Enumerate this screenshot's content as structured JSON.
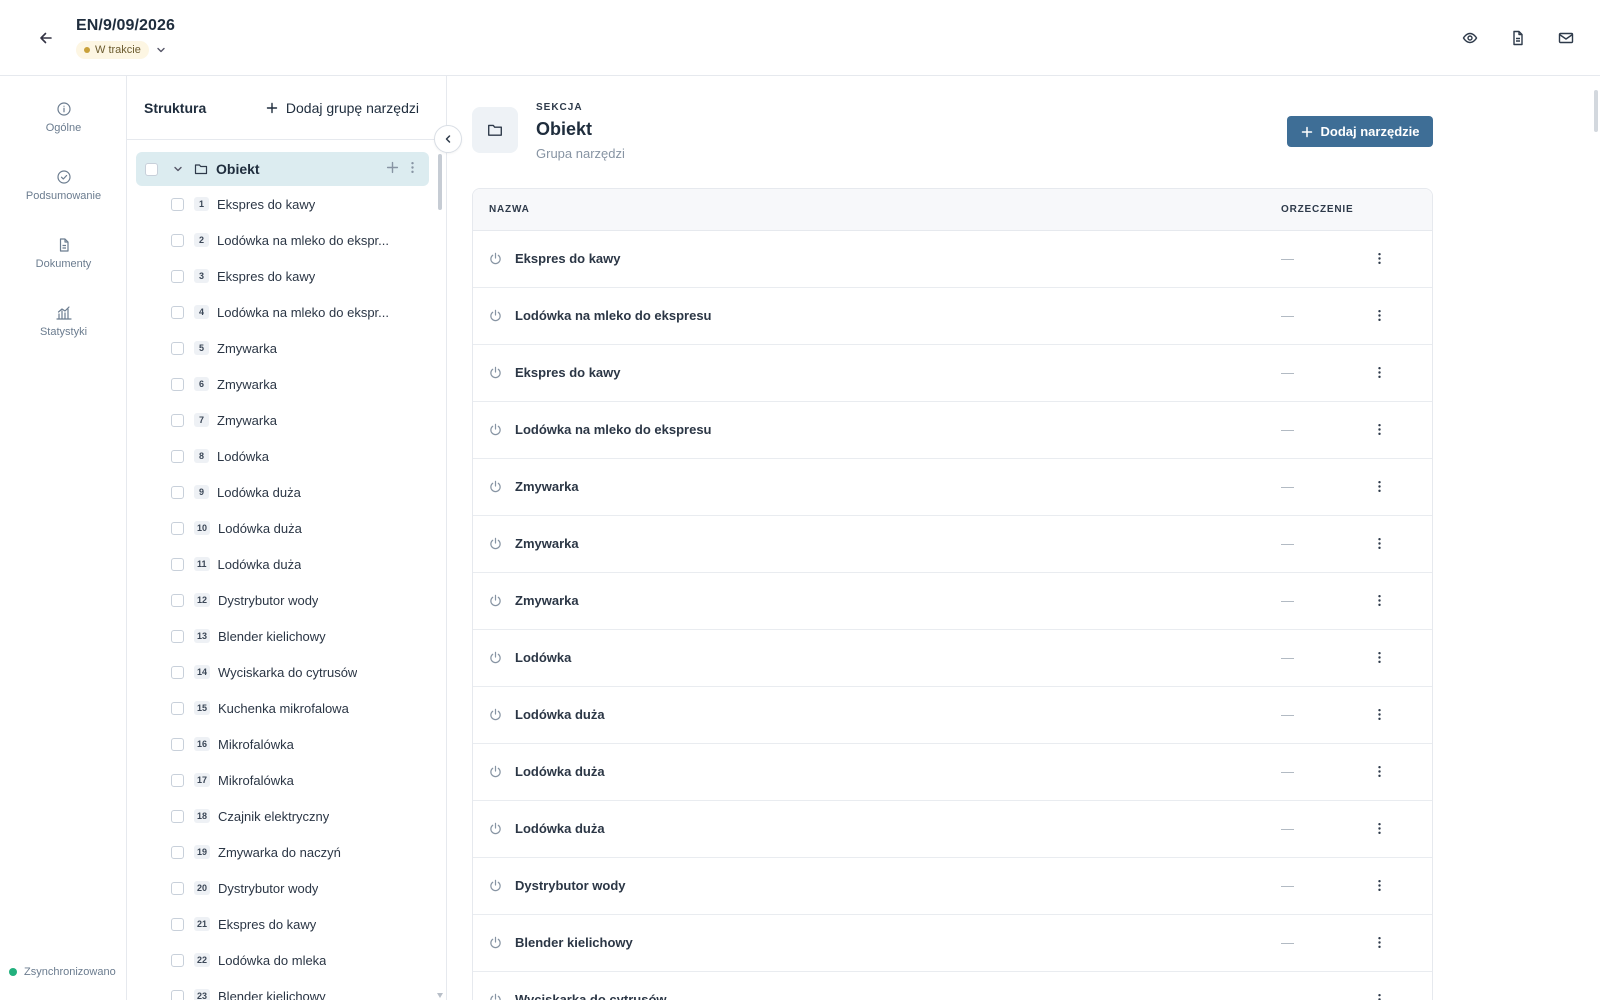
{
  "header": {
    "title": "EN/9/09/2026",
    "status": "W trakcie",
    "status_color": "#c9a13a",
    "actions": [
      "eye-icon",
      "document-icon",
      "mail-icon"
    ]
  },
  "nav": {
    "items": [
      {
        "label": "Ogólne",
        "icon": "info-icon"
      },
      {
        "label": "Podsumowanie",
        "icon": "check-circle-icon"
      },
      {
        "label": "Dokumenty",
        "icon": "document-icon"
      },
      {
        "label": "Statystyki",
        "icon": "chart-icon"
      }
    ],
    "sync_label": "Zsynchronizowano",
    "sync_color": "#22b07d"
  },
  "tree": {
    "title": "Struktura",
    "add_group_label": "Dodaj grupę narzędzi",
    "root_label": "Obiekt",
    "items": [
      {
        "num": "1",
        "label": "Ekspres do kawy"
      },
      {
        "num": "2",
        "label": "Lodówka na mleko do ekspr..."
      },
      {
        "num": "3",
        "label": "Ekspres do kawy"
      },
      {
        "num": "4",
        "label": "Lodówka na mleko do ekspr..."
      },
      {
        "num": "5",
        "label": "Zmywarka"
      },
      {
        "num": "6",
        "label": "Zmywarka"
      },
      {
        "num": "7",
        "label": "Zmywarka"
      },
      {
        "num": "8",
        "label": "Lodówka"
      },
      {
        "num": "9",
        "label": "Lodówka duża"
      },
      {
        "num": "10",
        "label": "Lodówka duża"
      },
      {
        "num": "11",
        "label": "Lodówka duża"
      },
      {
        "num": "12",
        "label": "Dystrybutor wody"
      },
      {
        "num": "13",
        "label": "Blender kielichowy"
      },
      {
        "num": "14",
        "label": "Wyciskarka do cytrusów"
      },
      {
        "num": "15",
        "label": "Kuchenka mikrofalowa"
      },
      {
        "num": "16",
        "label": "Mikrofalówka"
      },
      {
        "num": "17",
        "label": "Mikrofalówka"
      },
      {
        "num": "18",
        "label": "Czajnik elektryczny"
      },
      {
        "num": "19",
        "label": "Zmywarka do naczyń"
      },
      {
        "num": "20",
        "label": "Dystrybutor wody"
      },
      {
        "num": "21",
        "label": "Ekspres do kawy"
      },
      {
        "num": "22",
        "label": "Lodówka do mleka"
      },
      {
        "num": "23",
        "label": "Blender kielichowy"
      }
    ]
  },
  "main": {
    "eyebrow": "SEKCJA",
    "title": "Obiekt",
    "subtitle": "Grupa narzędzi",
    "add_tool_label": "Dodaj narzędzie",
    "accent": "#3e6e96",
    "table": {
      "columns": [
        "NAZWA",
        "ORZECZENIE"
      ],
      "rows": [
        {
          "name": "Ekspres do kawy",
          "verdict": "—"
        },
        {
          "name": "Lodówka na mleko do ekspresu",
          "verdict": "—"
        },
        {
          "name": "Ekspres do kawy",
          "verdict": "—"
        },
        {
          "name": "Lodówka na mleko do ekspresu",
          "verdict": "—"
        },
        {
          "name": "Zmywarka",
          "verdict": "—"
        },
        {
          "name": "Zmywarka",
          "verdict": "—"
        },
        {
          "name": "Zmywarka",
          "verdict": "—"
        },
        {
          "name": "Lodówka",
          "verdict": "—"
        },
        {
          "name": "Lodówka duża",
          "verdict": "—"
        },
        {
          "name": "Lodówka duża",
          "verdict": "—"
        },
        {
          "name": "Lodówka duża",
          "verdict": "—"
        },
        {
          "name": "Dystrybutor wody",
          "verdict": "—"
        },
        {
          "name": "Blender kielichowy",
          "verdict": "—"
        },
        {
          "name": "Wyciskarka do cytrusów",
          "verdict": "—"
        }
      ]
    }
  }
}
